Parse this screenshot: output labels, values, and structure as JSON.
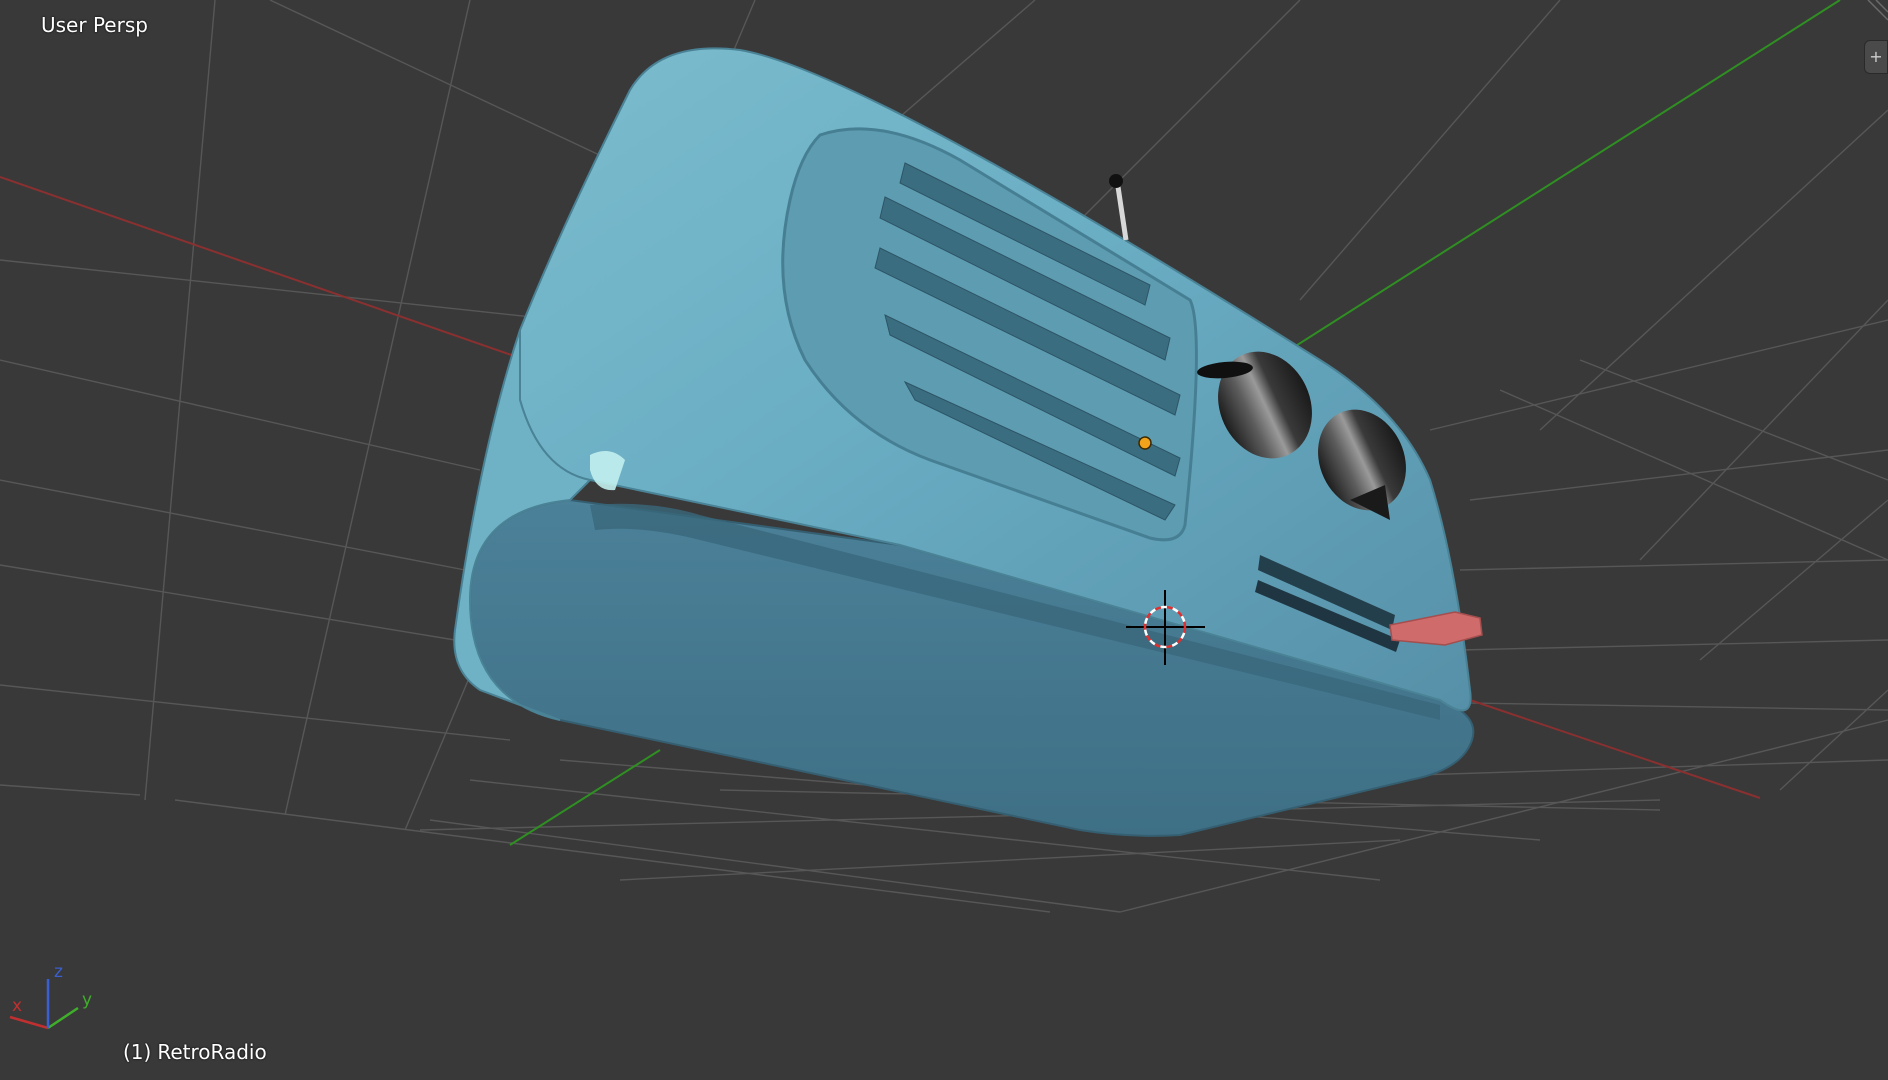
{
  "viewport": {
    "view_label": "User Persp",
    "object_index": "(1)",
    "object_name": "RetroRadio"
  },
  "axis_gizmo": {
    "x_label": "x",
    "y_label": "y",
    "z_label": "z"
  },
  "icons": {
    "corner_widget": "plus-icon",
    "cursor": "3d-cursor-icon",
    "origin": "object-origin-icon"
  },
  "colors": {
    "background": "#393939",
    "grid": "#555555",
    "x_axis": "#9a3535",
    "y_axis": "#3f9a2b",
    "radio_body": "#5a99b0",
    "radio_dark": "#3c6f82",
    "knob": "#2b2b2b",
    "tuner_handle": "#cf6b6b",
    "origin_dot": "#f2a31c"
  }
}
